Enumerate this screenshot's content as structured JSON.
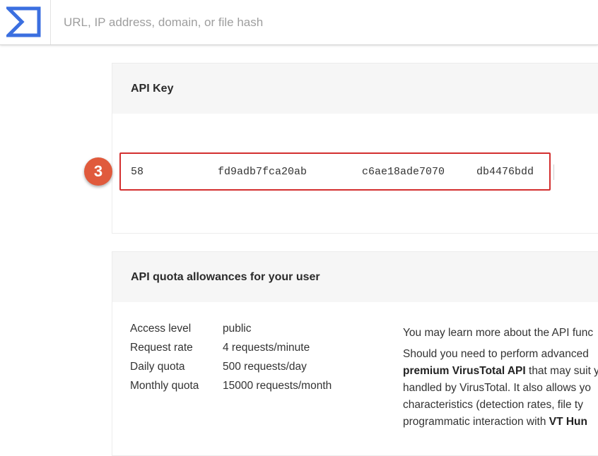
{
  "header": {
    "search_placeholder": "URL, IP address, domain, or file hash"
  },
  "api_key_card": {
    "title": "API Key",
    "key_parts": [
      "58",
      "fd9adb7fca20ab",
      "c6ae18ade7070",
      "db4476bdd"
    ],
    "step_number": "3"
  },
  "quota_card": {
    "title": "API quota allowances for your user",
    "rows": [
      {
        "label": "Access level",
        "value": "public"
      },
      {
        "label": "Request rate",
        "value": "4 requests/minute"
      },
      {
        "label": "Daily quota",
        "value": "500 requests/day"
      },
      {
        "label": "Monthly quota",
        "value": "15000 requests/month"
      }
    ],
    "info_lines": {
      "line1": "You may learn more about the API func",
      "line2": "Should you need to perform advanced",
      "line3_bold": "premium VirusTotal API",
      "line3_rest": " that may suit y",
      "line4": "handled by VirusTotal. It also allows yo",
      "line5": "characteristics (detection rates, file ty",
      "line6_rest": "programmatic interaction with ",
      "line6_bold": "VT Hun"
    }
  },
  "colors": {
    "brand_blue": "#3b6fe0",
    "highlight_red": "#d32f2f",
    "step_badge": "#e05a3c"
  },
  "icons": {
    "logo": "virustotal-sigma-logo"
  }
}
